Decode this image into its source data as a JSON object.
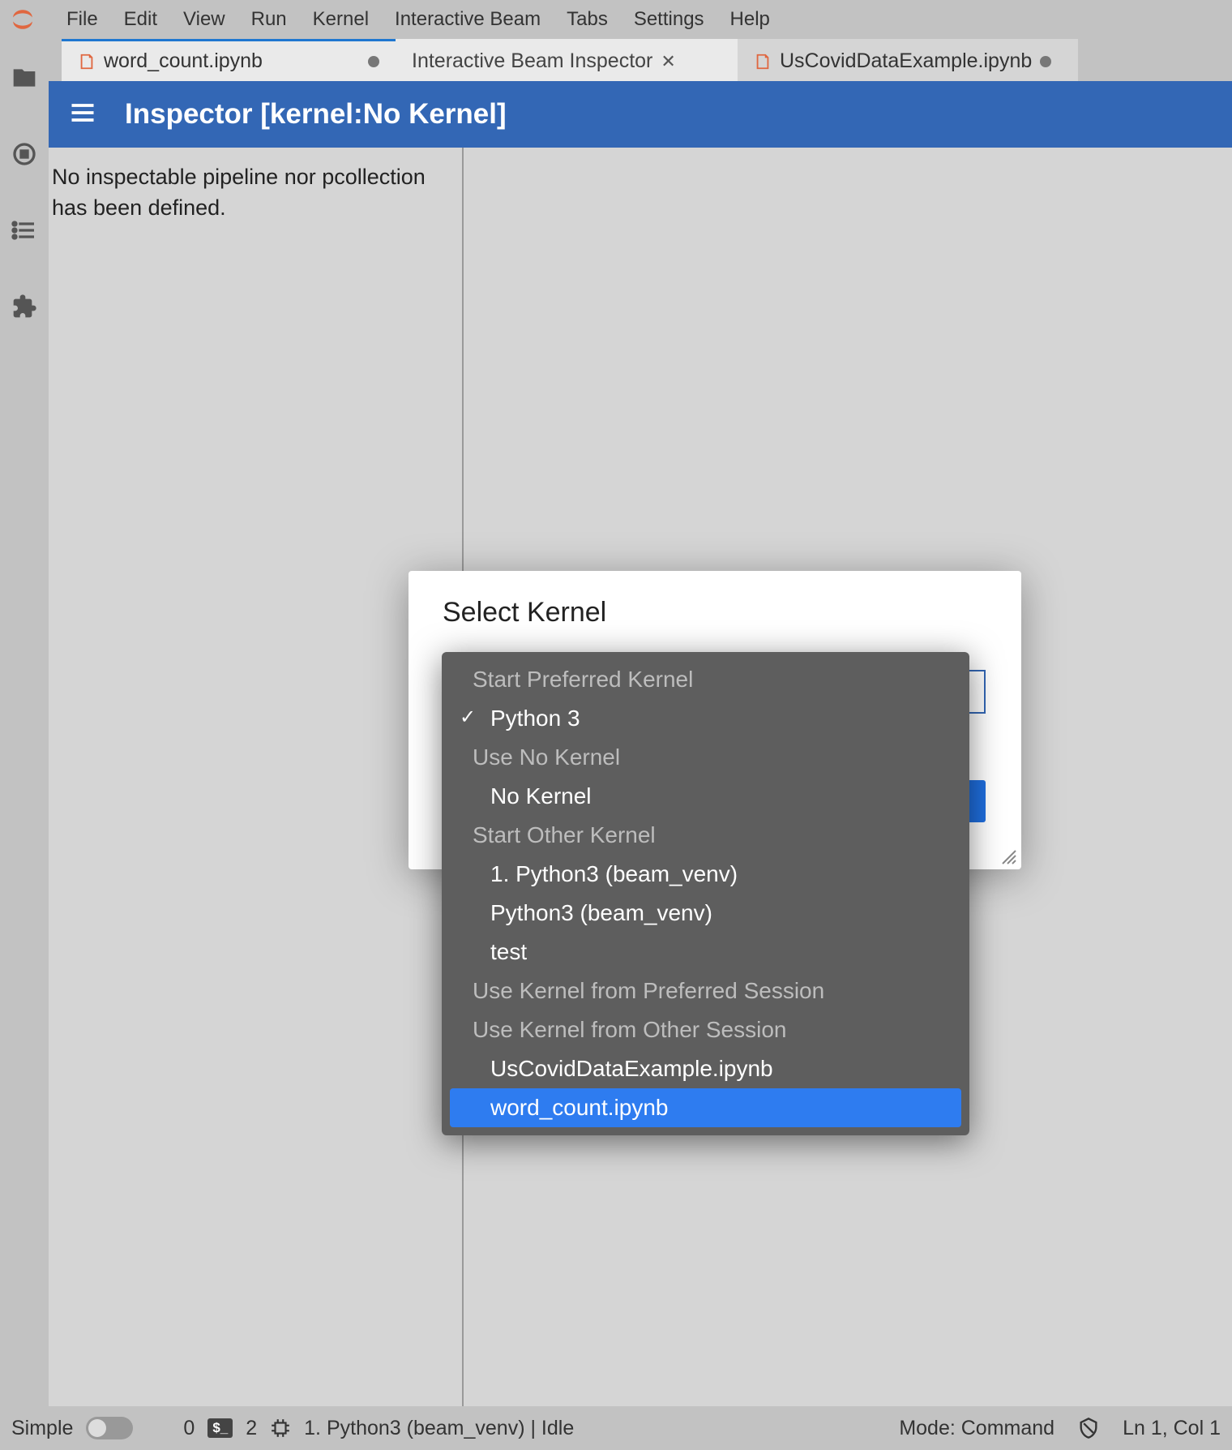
{
  "menu": {
    "items": [
      "File",
      "Edit",
      "View",
      "Run",
      "Kernel",
      "Interactive Beam",
      "Tabs",
      "Settings",
      "Help"
    ]
  },
  "tabs": [
    {
      "label": "word_count.ipynb",
      "type": "notebook",
      "dirty": true,
      "active_bar": true
    },
    {
      "label": "Interactive Beam Inspector",
      "type": "inspector",
      "closable": true,
      "active": true
    },
    {
      "label": "UsCovidDataExample.ipynb",
      "type": "notebook",
      "dirty": true,
      "truncated": true
    }
  ],
  "inspector": {
    "title": "Inspector [kernel:No Kernel]",
    "message": "No inspectable pipeline nor pcollection has been defined."
  },
  "dialog": {
    "title": "Select Kernel"
  },
  "dropdown": {
    "groups": [
      {
        "header": "Start Preferred Kernel",
        "items": [
          {
            "label": "Python 3",
            "checked": true
          }
        ]
      },
      {
        "header": "Use No Kernel",
        "items": [
          {
            "label": "No Kernel"
          }
        ]
      },
      {
        "header": "Start Other Kernel",
        "items": [
          {
            "label": "1. Python3 (beam_venv)"
          },
          {
            "label": "Python3 (beam_venv)"
          },
          {
            "label": "test"
          }
        ]
      },
      {
        "header": "Use Kernel from Preferred Session",
        "items": []
      },
      {
        "header": "Use Kernel from Other Session",
        "items": [
          {
            "label": "UsCovidDataExample.ipynb"
          },
          {
            "label": "word_count.ipynb",
            "highlighted": true
          }
        ]
      }
    ]
  },
  "statusbar": {
    "simple": "Simple",
    "count1": "0",
    "count2": "2",
    "kernel": "1. Python3 (beam_venv) | Idle",
    "mode": "Mode: Command",
    "position": "Ln 1, Col 1"
  }
}
